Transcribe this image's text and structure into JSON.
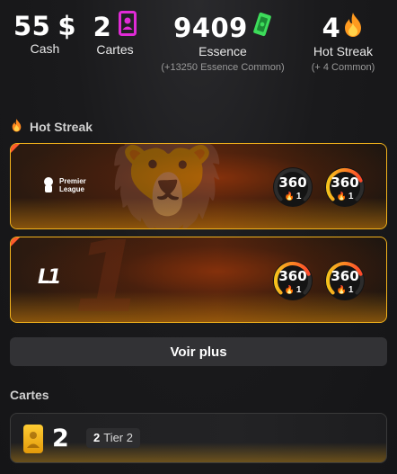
{
  "stats": {
    "cash": {
      "value": "55",
      "unit": "$",
      "label": "Cash"
    },
    "cartes": {
      "value": "2",
      "label": "Cartes",
      "icon": "card-person-icon",
      "color": "#e02bd6"
    },
    "essence": {
      "value": "9409",
      "label": "Essence",
      "sub": "(+13250 Essence Common)",
      "icon": "essence-ticket-icon",
      "color": "#3ddc5a"
    },
    "hot_streak": {
      "value": "4",
      "label": "Hot Streak",
      "sub": "(+ 4 Common)",
      "icon": "flame-icon",
      "color": "#ff9a1f"
    }
  },
  "hot_streak_section": {
    "title": "Hot Streak",
    "leagues": [
      {
        "name": "Premier League",
        "logo_line1": "Premier",
        "logo_line2": "League",
        "gauges": [
          {
            "score": "360",
            "count": "1",
            "level": 0.0,
            "flame": "flame-icon"
          },
          {
            "score": "360",
            "count": "1",
            "level": 0.75,
            "flame": "flame-icon"
          }
        ]
      },
      {
        "name": "Ligue 1",
        "logo_text": "L1",
        "gauges": [
          {
            "score": "360",
            "count": "1",
            "level": 0.75,
            "flame": "flame-icon"
          },
          {
            "score": "360",
            "count": "1",
            "level": 0.75,
            "flame": "flame-icon"
          }
        ]
      }
    ],
    "voir_plus": "Voir plus"
  },
  "cartes_section": {
    "title": "Cartes",
    "tier_count": "2",
    "tier_badge_count": "2",
    "tier_badge_label": "Tier 2"
  },
  "colors": {
    "accent_orange": "#f2b21c",
    "accent_red": "#ff5a2c",
    "pink": "#e02bd6",
    "green": "#3ddc5a"
  }
}
